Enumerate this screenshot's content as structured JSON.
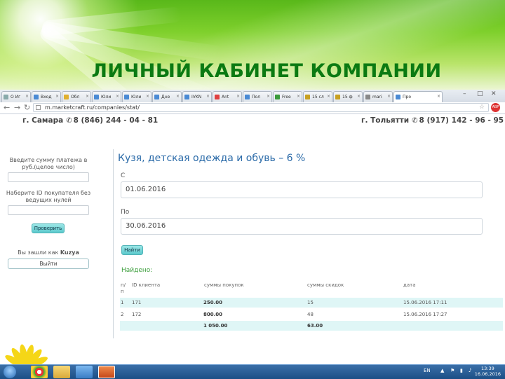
{
  "slide_title": "ЛИЧНЫЙ КАБИНЕТ КОМПАНИИ",
  "browser": {
    "tabs": [
      {
        "label": "О Иг",
        "color": "#8aa"
      },
      {
        "label": "Вход",
        "color": "#4a8ad4"
      },
      {
        "label": "Обл",
        "color": "#e0b030"
      },
      {
        "label": "Юли",
        "color": "#4a8ad4"
      },
      {
        "label": "Юли",
        "color": "#4a8ad4"
      },
      {
        "label": "Дне",
        "color": "#4a8ad4"
      },
      {
        "label": "IVKN",
        "color": "#4a8ad4"
      },
      {
        "label": "Ant",
        "color": "#e04040"
      },
      {
        "label": "Пол",
        "color": "#4a8ad4"
      },
      {
        "label": "Free",
        "color": "#3a9a3a"
      },
      {
        "label": "15 сл",
        "color": "#c8a020"
      },
      {
        "label": "15 ф",
        "color": "#c8a020"
      },
      {
        "label": "mari",
        "color": "#888"
      },
      {
        "label": "Про",
        "color": "#4a8ad4"
      }
    ],
    "url": "m.marketcraft.ru/companies/stat/",
    "ext_badge": "ABP"
  },
  "contacts": {
    "left_city": "г. Самара",
    "left_phone": "8 (846) 244 - 04 - 81",
    "right_city": "г. Тольятти",
    "right_phone": "8 (917) 142 - 96 - 95"
  },
  "sidebar": {
    "payment_label": "Введите сумму платежа в руб.(целое число)",
    "buyer_label": "Наберите ID покупателя без ведущих нулей",
    "check_button": "Проверить",
    "logged_in_text": "Вы зашли как",
    "username": "Kuzya",
    "exit_button": "Выйти"
  },
  "main": {
    "company_title": "Кузя, детская одежда и обувь – 6 %",
    "from_label": "С",
    "from_value": "01.06.2016",
    "to_label": "По",
    "to_value": "30.06.2016",
    "find_button": "Найти",
    "found_label": "Найдено:",
    "table": {
      "headers": [
        "п/п",
        "ID клиента",
        "суммы покупок",
        "суммы скидок",
        "дата"
      ],
      "rows": [
        [
          "1",
          "171",
          "250.00",
          "15",
          "15.06.2016 17:11"
        ],
        [
          "2",
          "172",
          "800.00",
          "48",
          "15.06.2016 17:27"
        ]
      ],
      "totals": [
        "",
        "",
        "1 050.00",
        "63.00",
        ""
      ]
    }
  },
  "taskbar": {
    "lang": "EN",
    "time": "13:39",
    "date": "16.06.2016"
  }
}
